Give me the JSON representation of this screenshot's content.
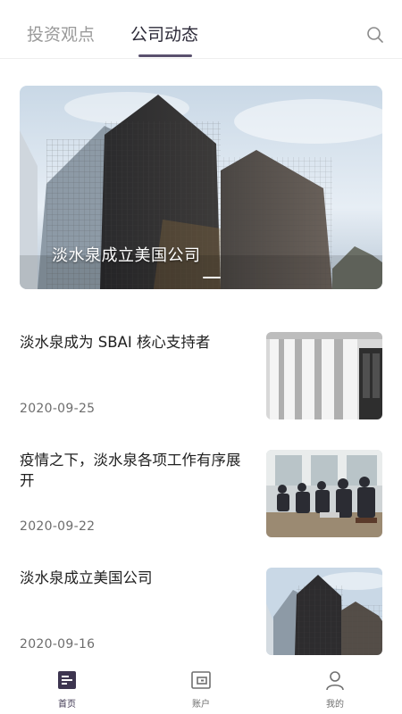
{
  "header": {
    "tabs": [
      {
        "label": "投资观点",
        "active": false
      },
      {
        "label": "公司动态",
        "active": true
      }
    ],
    "search_icon": "search-icon"
  },
  "banner": {
    "caption": "淡水泉成立美国公司"
  },
  "news": [
    {
      "title": "淡水泉成为 SBAI 核心支持者",
      "date": "2020-09-25",
      "thumb": "columns"
    },
    {
      "title": "疫情之下，淡水泉各项工作有序展开",
      "date": "2020-09-22",
      "thumb": "meeting"
    },
    {
      "title": "淡水泉成立美国公司",
      "date": "2020-09-16",
      "thumb": "buildings"
    }
  ],
  "nav": [
    {
      "label": "首页",
      "icon": "home-icon",
      "active": true
    },
    {
      "label": "账户",
      "icon": "wallet-icon",
      "active": false
    },
    {
      "label": "我的",
      "icon": "user-icon",
      "active": false
    }
  ],
  "colors": {
    "accent": "#5a516e",
    "inactive_tab": "#9a9a9a",
    "date": "#6d6d6d"
  }
}
